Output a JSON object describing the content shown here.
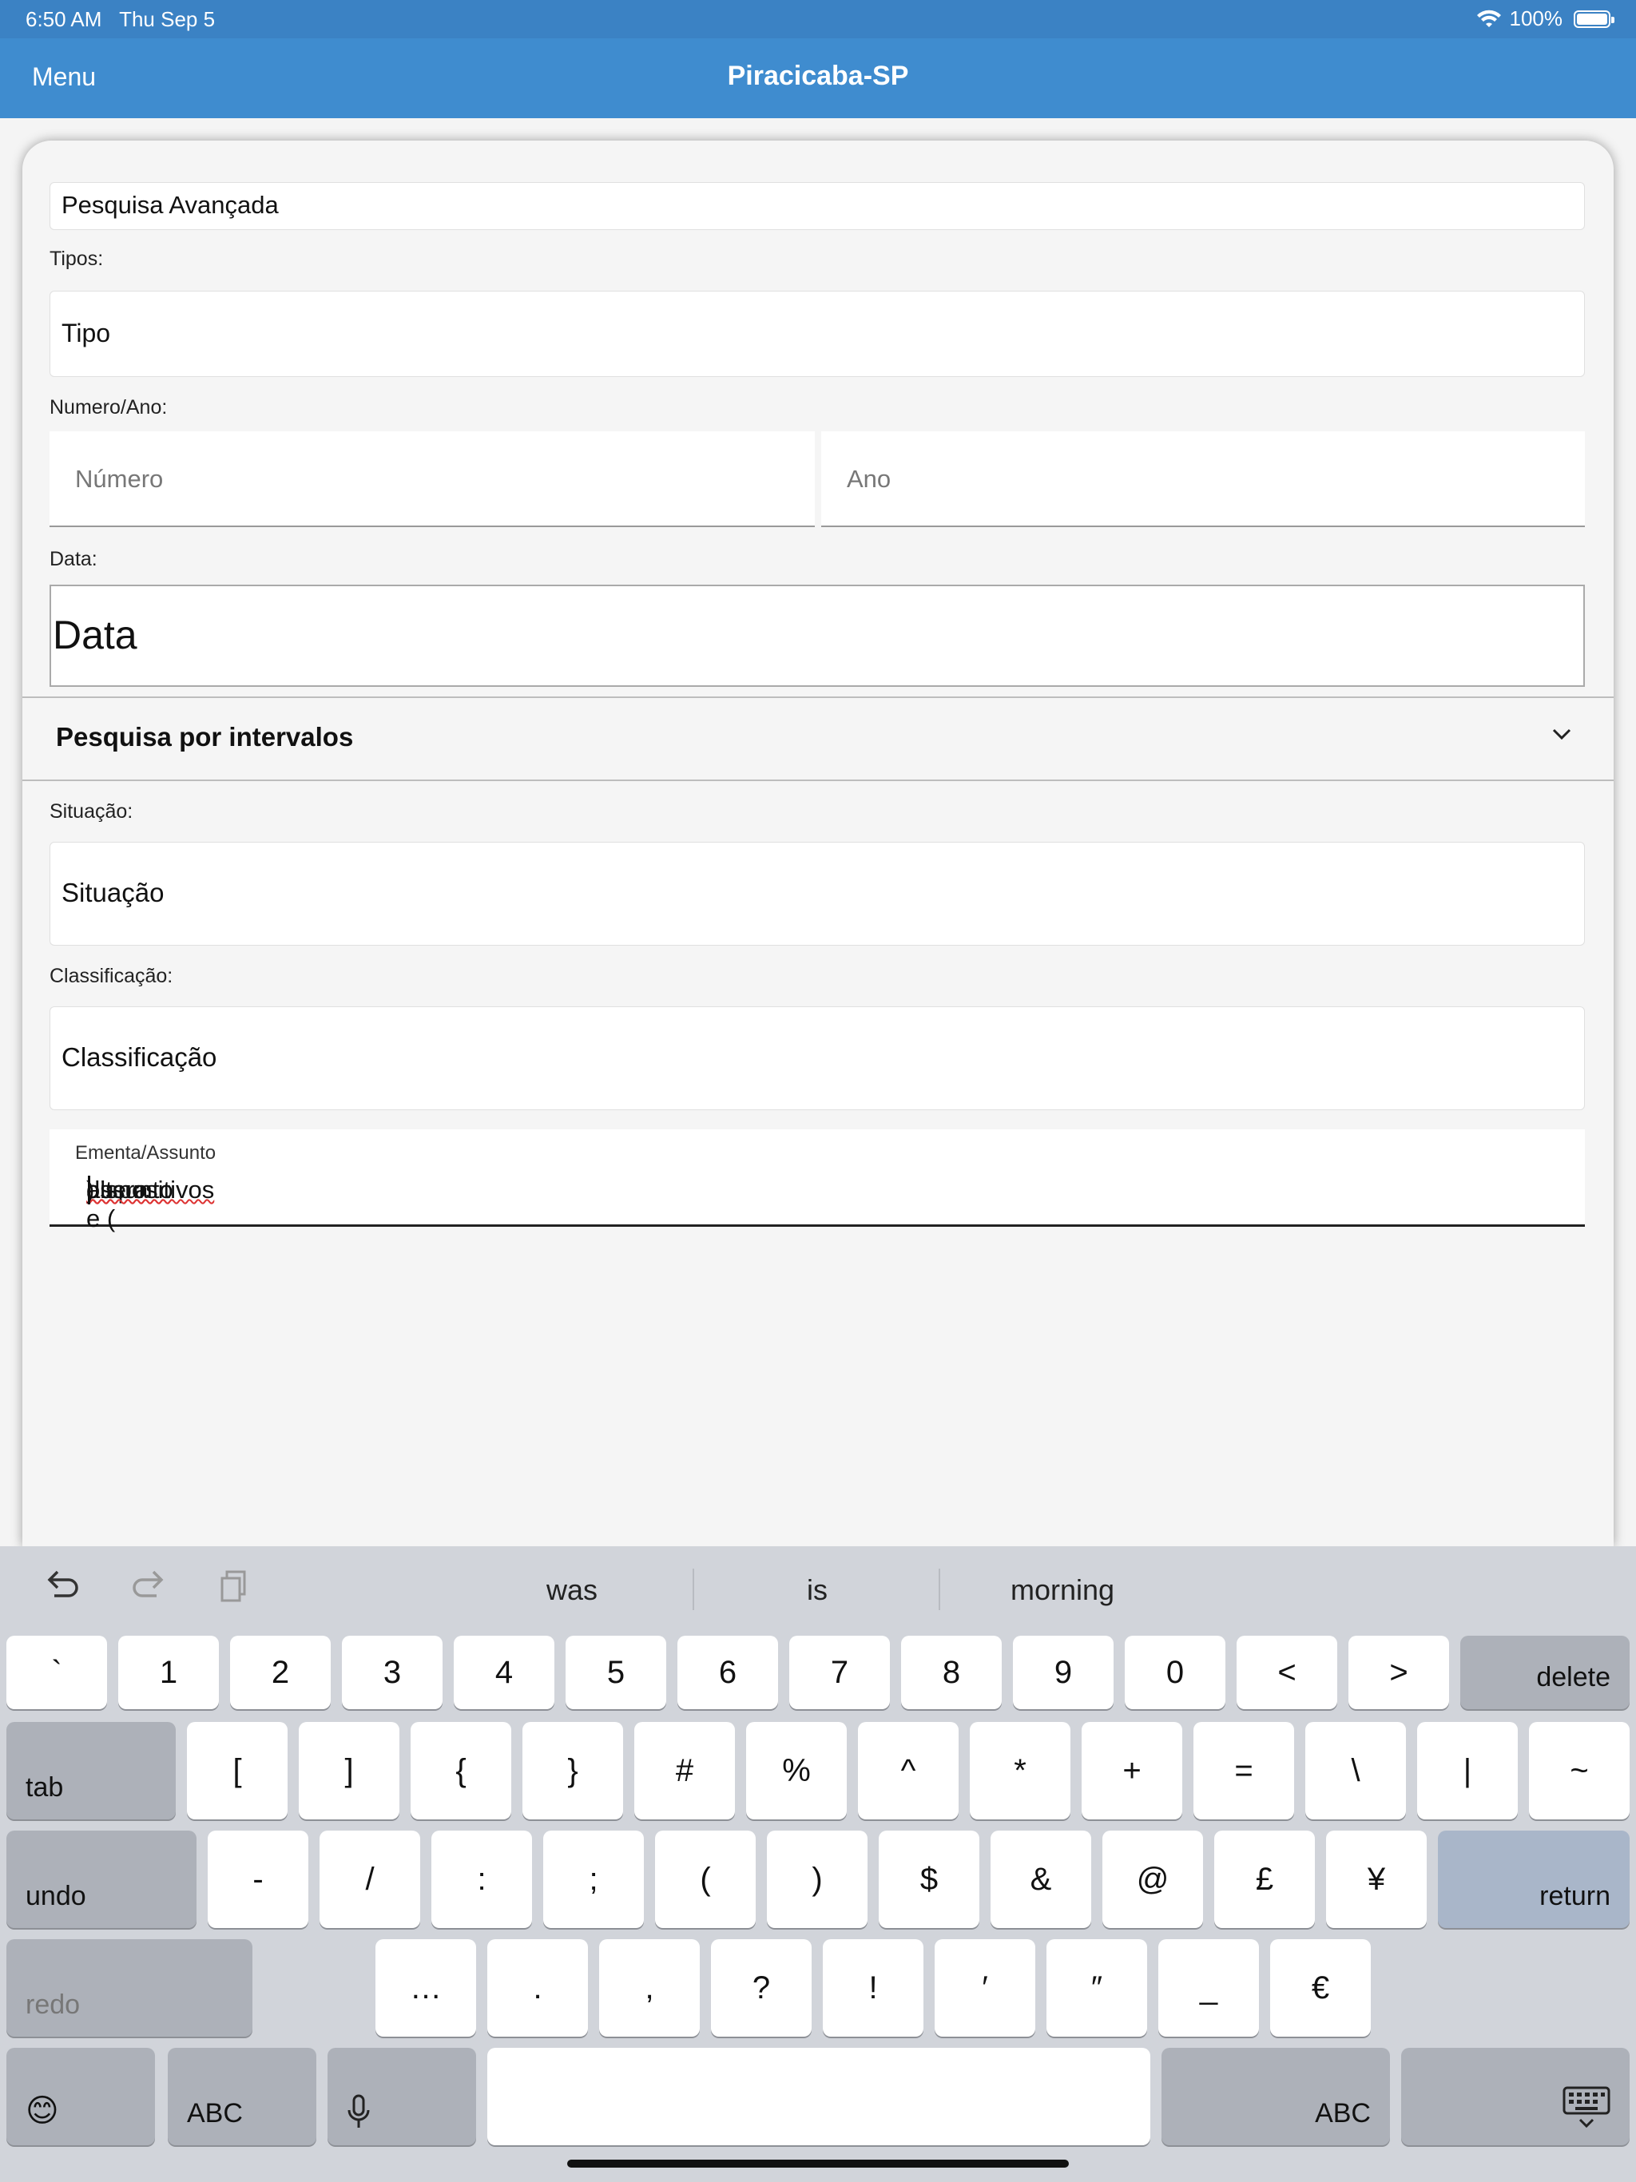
{
  "status": {
    "time": "6:50 AM",
    "date": "Thu Sep 5",
    "battery": "100%"
  },
  "nav": {
    "menu": "Menu",
    "title": "Piracicaba-SP"
  },
  "form": {
    "section_title": "Pesquisa Avançada",
    "tipos_label": "Tipos:",
    "tipo_value": "Tipo",
    "numero_ano_label": "Numero/Ano:",
    "numero_placeholder": "Número",
    "ano_placeholder": "Ano",
    "data_label": "Data:",
    "data_value": "Data",
    "intervalos": "Pesquisa por intervalos",
    "situacao_label": "Situação:",
    "situacao_value": "Situação",
    "classificacao_label": "Classificação:",
    "classificacao_value": "Classificação",
    "ementa_label": "Ementa/Assunto",
    "ementa_value_a": "altera e (",
    "ementa_value_b": "dispositivos",
    "ementa_value_c": " ",
    "ementa_value_d": "ou",
    "ementa_value_e": " ",
    "ementa_value_f": "assunto",
    "ementa_value_g": ")"
  },
  "keyboard": {
    "suggestions": [
      "was",
      "is",
      "morning"
    ],
    "row1": [
      "`",
      "1",
      "2",
      "3",
      "4",
      "5",
      "6",
      "7",
      "8",
      "9",
      "0",
      "<",
      ">"
    ],
    "row2": [
      "[",
      "]",
      "{",
      "}",
      "#",
      "%",
      "^",
      "*",
      "+",
      "=",
      "\\",
      "|",
      "~"
    ],
    "row3": [
      "-",
      "/",
      ":",
      ";",
      "(",
      ")",
      "$",
      "&",
      "@",
      "£",
      "¥"
    ],
    "row4": [
      "…",
      ".",
      ",",
      "?",
      "!",
      "′",
      "″",
      "_",
      "€"
    ],
    "delete": "delete",
    "tab": "tab",
    "undo": "undo",
    "return": "return",
    "redo": "redo",
    "abc": "ABC",
    "emoji": "😊"
  }
}
